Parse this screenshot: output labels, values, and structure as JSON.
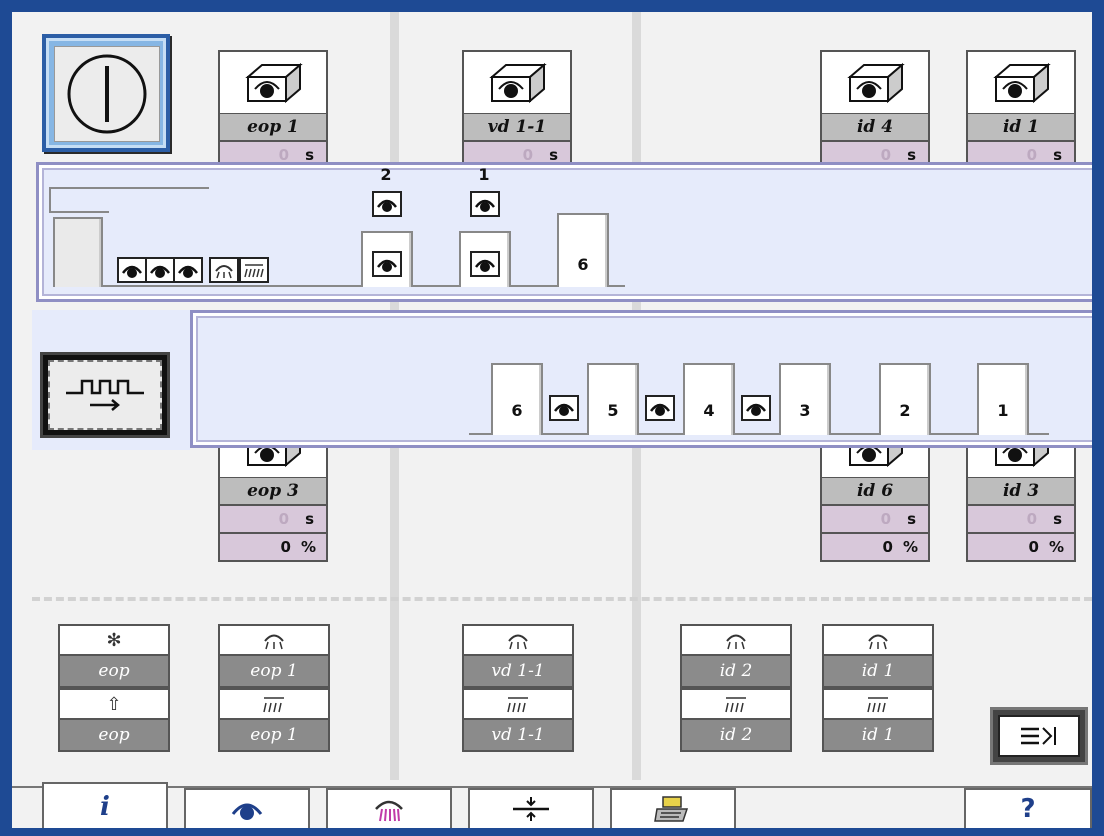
{
  "cameras": [
    {
      "label": "eop 1",
      "s_value": "0",
      "s_unit": "s"
    },
    {
      "label": "vd 1-1",
      "s_value": "0",
      "s_unit": "s"
    },
    {
      "label": "id 4",
      "s_value": "0",
      "s_unit": "s"
    },
    {
      "label": "id 1",
      "s_value": "0",
      "s_unit": "s"
    },
    {
      "label": "eop 3",
      "s_value": "0",
      "s_unit": "s",
      "pct_value": "0",
      "pct_unit": "%"
    },
    {
      "label": "id 6",
      "s_value": "0",
      "s_unit": "s",
      "pct_value": "0",
      "pct_unit": "%"
    },
    {
      "label": "id 3",
      "s_value": "0",
      "s_unit": "s",
      "pct_value": "0",
      "pct_unit": "%"
    }
  ],
  "top_panel": {
    "upper_numbers": [
      "2",
      "1"
    ],
    "slot_number": "6"
  },
  "sequence": [
    "6",
    "5",
    "4",
    "3",
    "2",
    "1"
  ],
  "bottom_controls": {
    "row1_labels": [
      "eop",
      "eop 1",
      "vd 1-1",
      "id 2",
      "id 1"
    ],
    "row2_labels": [
      "eop",
      "eop 1",
      "vd 1-1",
      "id 2",
      "id 1"
    ]
  },
  "tabs": {
    "info_icon": "info-icon",
    "camera_icon": "camera-eye-icon",
    "heater_icon": "heater-icon",
    "split_icon": "split-icon",
    "printer_icon": "printer-icon",
    "help_label": "?"
  },
  "colors": {
    "frame": "#1e4a94",
    "panel": "#e6ebfb",
    "label_bg": "#bdbdbd",
    "stat_bg": "#d8c8da"
  }
}
